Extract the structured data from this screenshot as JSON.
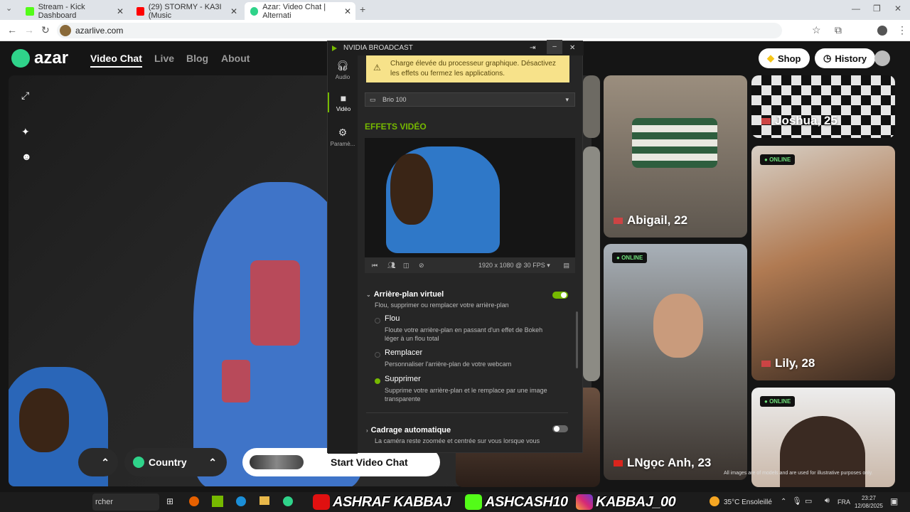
{
  "browser": {
    "tabs": [
      {
        "title": "Stream - Kick Dashboard",
        "color": "#53fc18"
      },
      {
        "title": "(29) STORMY - KA3I (Music",
        "color": "#ff0000"
      },
      {
        "title": "Azar: Video Chat | Alternati",
        "color": "#2fd38a"
      }
    ],
    "url": "azarlive.com"
  },
  "site": {
    "brand": "azar",
    "nav": [
      "Video Chat",
      "Live",
      "Blog",
      "About"
    ],
    "shop": "Shop",
    "history": "History",
    "profiles": [
      {
        "name": "Joshua, 25"
      },
      {
        "name": "Abigail, 22"
      },
      {
        "name": "Lily, 28",
        "badge": "ONLINE"
      },
      {
        "name": "LNgọc Anh, 23",
        "badge": "ONLINE"
      },
      {
        "badge": "ONLINE"
      }
    ],
    "country": "Country",
    "start": "Start Video Chat",
    "disclaimer": "All images are of models and are used for illustrative purposes only."
  },
  "nvidia": {
    "title": "NVIDIA BROADCAST",
    "side": [
      {
        "label": "Audio",
        "icon": "headphones-icon"
      },
      {
        "label": "Vidéo",
        "icon": "camera-icon"
      },
      {
        "label": "Paramè...",
        "icon": "gear-icon"
      }
    ],
    "warning": "Charge élevée du processeur graphique. Désactivez les effets ou fermez les applications.",
    "device": "Brio 100",
    "effects_title": "EFFETS VIDÉO",
    "resolution": "1920 x 1080 @ 30 FPS",
    "bg_title": "Arrière-plan virtuel",
    "bg_sub": "Flou, supprimer ou remplacer votre arrière-plan",
    "options": [
      {
        "label": "Flou",
        "desc": "Floute votre arrière-plan en passant d'un effet de Bokeh léger à un flou total"
      },
      {
        "label": "Remplacer",
        "desc": "Personnaliser l'arrière-plan de votre webcam"
      },
      {
        "label": "Supprimer",
        "desc": "Supprime votre arrière-plan et le remplace par une image transparente"
      }
    ],
    "frame_title": "Cadrage automatique",
    "frame_sub": "La caméra reste zoomée et centrée sur vous lorsque vous",
    "accent": "#76b900"
  },
  "taskbar": {
    "search": "rcher",
    "socials": [
      "ASHRAF KABBAJ",
      "ASHCASH10",
      "KABBAJ_00"
    ],
    "weather": "35°C Ensoleillé",
    "lang": "FRA",
    "time": "23:27",
    "date": "12/08/2025"
  }
}
